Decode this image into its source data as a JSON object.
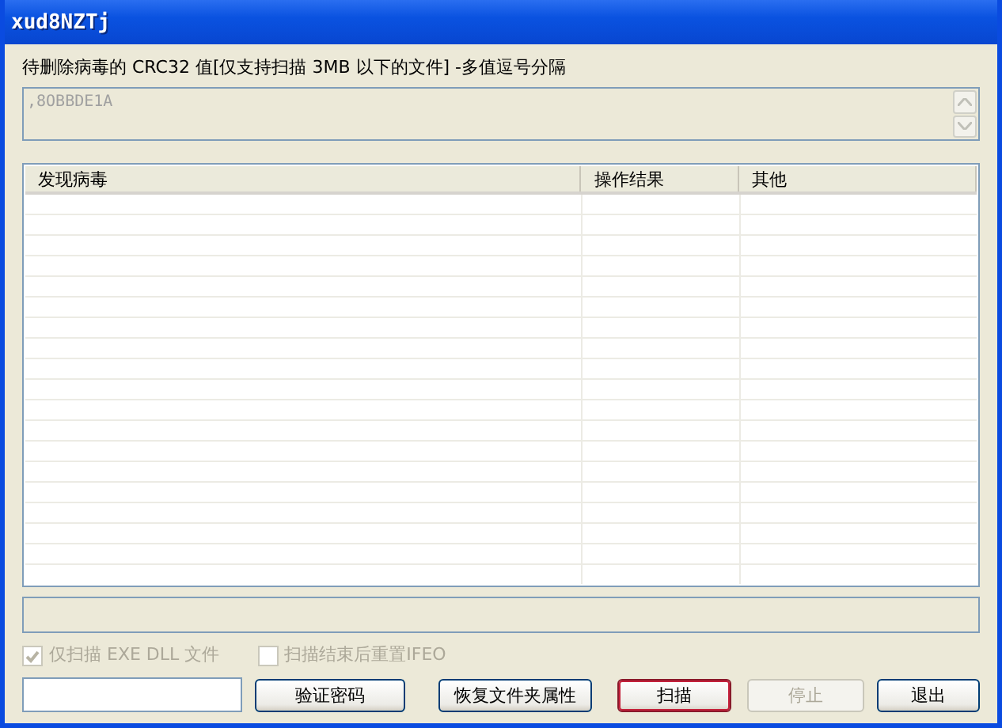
{
  "window": {
    "title": "xud8NZTj"
  },
  "crc_label": "待删除病毒的 CRC32 值[仅支持扫描 3MB 以下的文件] -多值逗号分隔",
  "crc_field": {
    "value": ",8OBBDE1A",
    "disabled": true
  },
  "table": {
    "columns": [
      "发现病毒",
      "操作结果",
      "其他"
    ]
  },
  "checkboxes": [
    {
      "label": "仅扫描 EXE DLL 文件",
      "checked": true,
      "disabled": true
    },
    {
      "label": "扫描结束后重置IFEO",
      "checked": false,
      "disabled": true
    }
  ],
  "buttons": [
    {
      "label": "验证密码",
      "default": false,
      "disabled": false
    },
    {
      "label": "恢复文件夹属性",
      "default": false,
      "disabled": false
    },
    {
      "label": "扫描",
      "default": true,
      "disabled": false
    },
    {
      "label": "停止",
      "default": false,
      "disabled": true
    },
    {
      "label": "退出",
      "default": false,
      "disabled": false
    }
  ]
}
